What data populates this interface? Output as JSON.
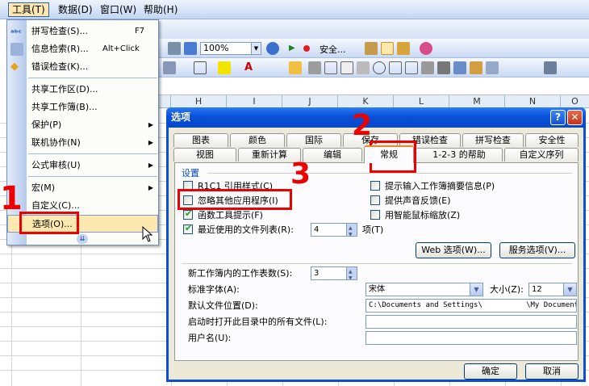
{
  "menubar": {
    "items": [
      "工具(T)",
      "数据(D)",
      "窗口(W)",
      "帮助(H)"
    ]
  },
  "toolbar": {
    "zoom": "100%",
    "security_label": "安全..."
  },
  "columns": [
    "H",
    "I",
    "J",
    "K",
    "L",
    "M",
    "N",
    "O"
  ],
  "tools_menu": {
    "items": [
      {
        "label": "拼写检查(S)...",
        "shortcut": "F7"
      },
      {
        "label": "信息检索(R)...",
        "shortcut": "Alt+Click"
      },
      {
        "label": "错误检查(K)..."
      },
      {
        "label": "共享工作区(D)..."
      },
      {
        "label": "共享工作簿(B)..."
      },
      {
        "label": "保护(P)"
      },
      {
        "label": "联机协作(N)"
      },
      {
        "label": "公式审核(U)"
      },
      {
        "label": "宏(M)"
      },
      {
        "label": "自定义(C)..."
      },
      {
        "label": "选项(O)..."
      }
    ]
  },
  "dialog": {
    "title": "选项",
    "help_btn": "?",
    "close_btn": "✕",
    "tabs_row1": [
      "图表",
      "颜色",
      "国际",
      "保存",
      "错误检查",
      "拼写检查",
      "安全性"
    ],
    "tabs_row2": [
      "视图",
      "重新计算",
      "编辑",
      "常规",
      "1-2-3 的帮助",
      "自定义序列"
    ],
    "group_label": "设置",
    "left_checks": [
      {
        "label": "R1C1 引用样式(C)",
        "checked": false
      },
      {
        "label": "忽略其他应用程序(I)",
        "checked": false
      },
      {
        "label": "函数工具提示(F)",
        "checked": true
      },
      {
        "label": "最近使用的文件列表(R):",
        "checked": true
      }
    ],
    "recent_count": "4",
    "recent_suffix": "项(T)",
    "right_checks": [
      {
        "label": "提示输入工作簿摘要信息(P)",
        "checked": false
      },
      {
        "label": "提供声音反馈(E)",
        "checked": false
      },
      {
        "label": "用智能鼠标缩放(Z)",
        "checked": false
      }
    ],
    "web_options": "Web 选项(W)...",
    "service_options": "服务选项(V)...",
    "sheets_label": "新工作簿内的工作表数(S):",
    "sheets_value": "3",
    "font_label": "标准字体(A):",
    "font_value": "宋体",
    "size_label": "大小(Z):",
    "size_value": "12",
    "default_path_label": "默认文件位置(D):",
    "default_path_value": "C:\\Documents and Settings\\          \\My Documents",
    "startup_label": "启动时打开此目录中的所有文件(L):",
    "username_label": "用户名(U):",
    "ok": "确定",
    "cancel": "取消"
  },
  "annotations": [
    "1",
    "2",
    "3"
  ]
}
